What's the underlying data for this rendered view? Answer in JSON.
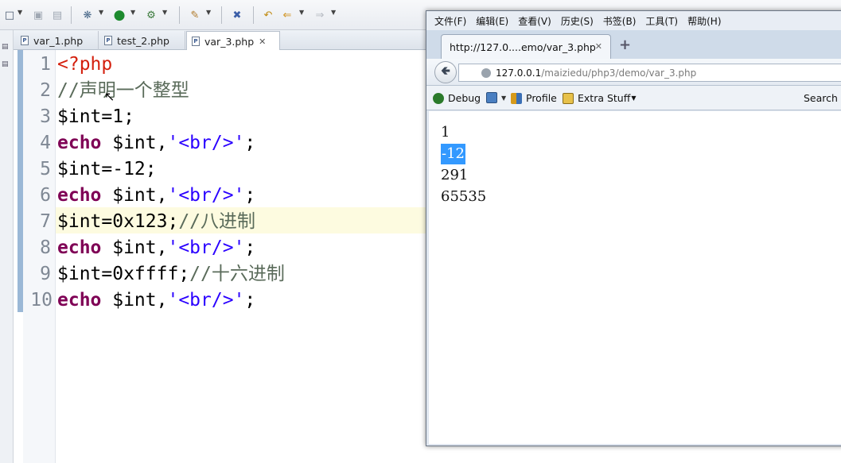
{
  "ide": {
    "tabs": [
      {
        "label": "var_1.php"
      },
      {
        "label": "test_2.php"
      },
      {
        "label": "var_3.php",
        "close": "✕"
      }
    ],
    "line_numbers": [
      "1",
      "2",
      "3",
      "4",
      "5",
      "6",
      "7",
      "8",
      "9",
      "10"
    ],
    "code": {
      "l1_tag": "<?php",
      "l2_comment": "//声明一个整型",
      "l3": "$int=1;",
      "l4_kw": "echo",
      "l4_var": " $int,",
      "l4_str": "'<br/>'",
      "l4_end": ";",
      "l5": "$int=-12;",
      "l6_kw": "echo",
      "l6_var": " $int,",
      "l6_str": "'<br/>'",
      "l6_end": ";",
      "l7": "$int=0x123;",
      "l7_comment": "//八进制",
      "l8_kw": "echo",
      "l8_var": " $int,",
      "l8_str": "'<br/>'",
      "l8_end": ";",
      "l9": "$int=0xffff;",
      "l9_comment": "//十六进制",
      "l10_kw": "echo",
      "l10_var": " $int,",
      "l10_str": "'<br/>'",
      "l10_end": ";"
    },
    "toolbar_icons": [
      "new-icon",
      "save-icon",
      "save-all-icon",
      "debug-icon",
      "run-icon",
      "external-tools-icon",
      "build-icon",
      "skip-breakpoints-icon",
      "last-edit-icon",
      "back-icon",
      "forward-icon"
    ]
  },
  "browser": {
    "menu": [
      "文件(F)",
      "编辑(E)",
      "查看(V)",
      "历史(S)",
      "书签(B)",
      "工具(T)",
      "帮助(H)"
    ],
    "tab_title": "http://127.0....emo/var_3.php",
    "tab_close": "✕",
    "new_tab": "+",
    "url_host": "127.0.0.1",
    "url_path": "/maiziedu/php3/demo/var_3.php",
    "bookmarks": {
      "debug": "Debug",
      "profile": "Profile",
      "extra": "Extra Stuff",
      "search": "Search f"
    },
    "output": [
      "1",
      "-12",
      "291",
      "65535"
    ]
  }
}
